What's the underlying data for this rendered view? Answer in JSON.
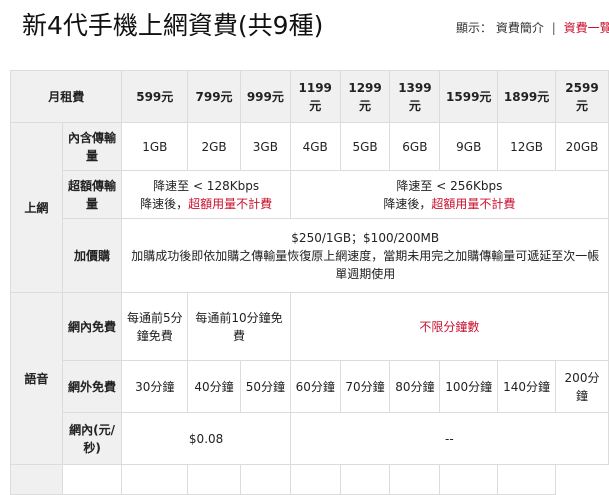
{
  "page": {
    "title": "新4代手機上網資費(共9種)",
    "display_label": "顯示：",
    "summary_view": "資費簡介",
    "separator": "|",
    "detail_view": "資費一覽表"
  },
  "table": {
    "monthly_fee_label": "月租費",
    "plans": [
      "599元",
      "799元",
      "999元",
      "1199元",
      "1299元",
      "1399元",
      "1599元",
      "1899元",
      "2599元"
    ],
    "data_section": "上網",
    "included_data_label": "內含傳輸量",
    "included_data": [
      "1GB",
      "2GB",
      "3GB",
      "4GB",
      "5GB",
      "6GB",
      "9GB",
      "12GB",
      "20GB"
    ],
    "overage_label": "超額傳輸量",
    "overage_low": {
      "speed": "降速至 < 128Kbps",
      "prefix": "降速後，",
      "red": "超額用量不計費"
    },
    "overage_high": {
      "speed": "降速至 < 256Kbps",
      "prefix": "降速後，",
      "red": "超額用量不計費"
    },
    "addon_label": "加價購",
    "addon_price": "$250/1GB；$100/200MB",
    "addon_desc": "加購成功後即依加購之傳輸量恢復原上網速度，當期未用完之加購傳輸量可遞延至次一帳單週期使用",
    "voice_section": "語音",
    "onnet_free_label": "網內免費",
    "onnet_free_599": "每通前5分鐘免費",
    "onnet_free_799_999": "每通前10分鐘免費",
    "onnet_free_rest": "不限分鐘數",
    "offnet_free_label": "網外免費",
    "offnet_free": [
      "30分鐘",
      "40分鐘",
      "50分鐘",
      "60分鐘",
      "70分鐘",
      "80分鐘",
      "100分鐘",
      "140分鐘",
      "200分鐘"
    ],
    "onnet_rate_label": "網內(元/秒)",
    "onnet_rate_low": "$0.08",
    "onnet_rate_high": "--"
  },
  "colors": {
    "accent_red": "#c8102e",
    "header_bg": "#f0f0f0",
    "border": "#dcdcdc"
  }
}
